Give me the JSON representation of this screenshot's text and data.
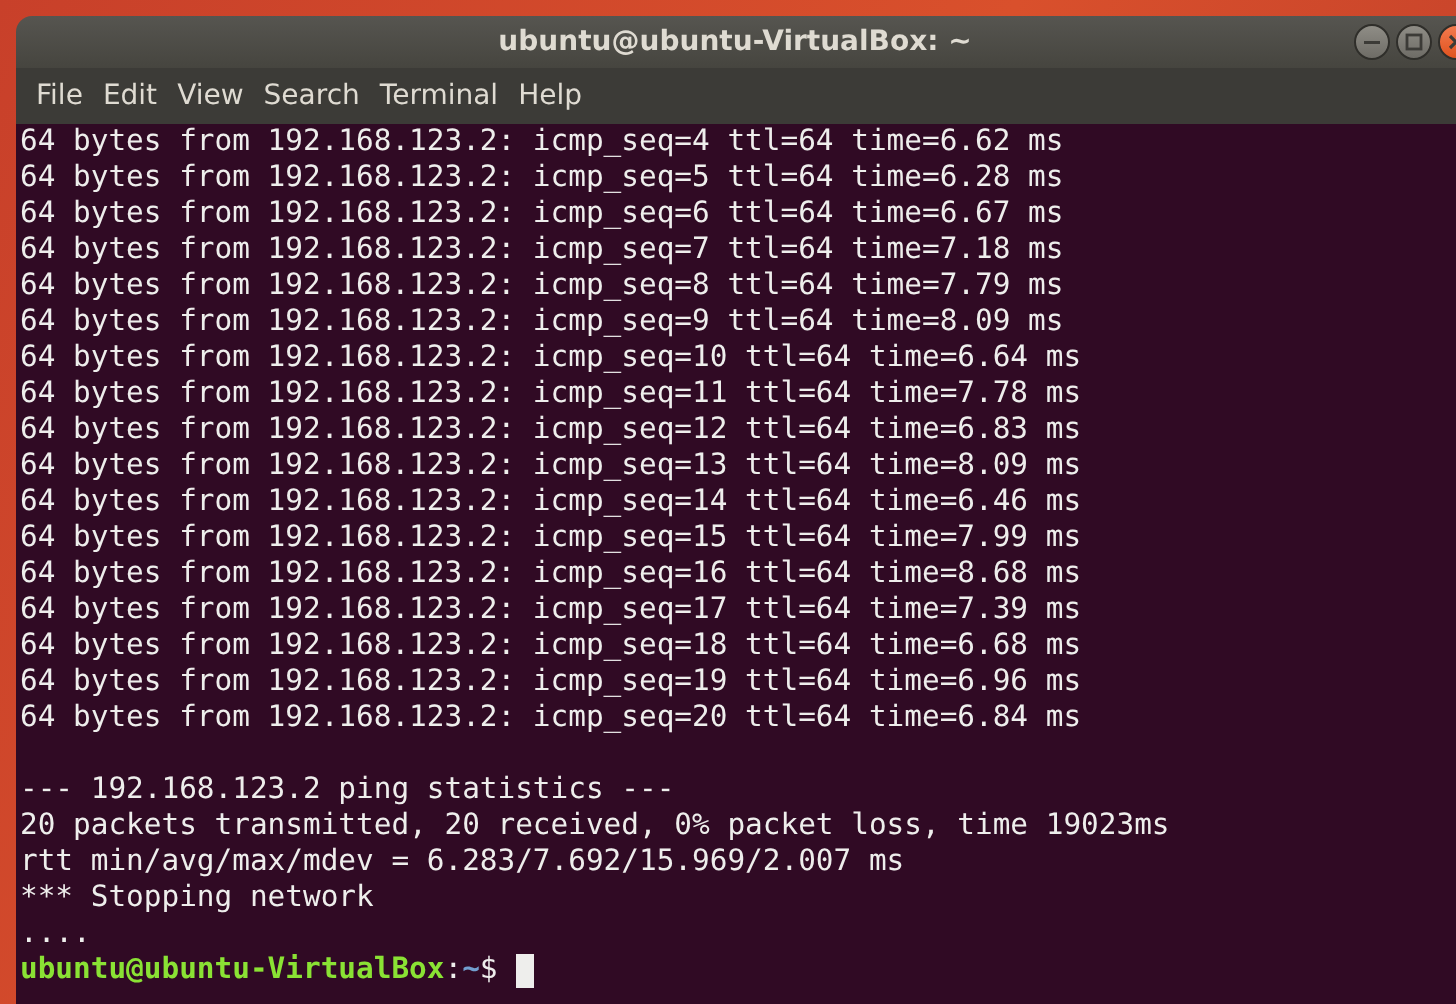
{
  "window": {
    "title": "ubuntu@ubuntu-VirtualBox: ~"
  },
  "menu": [
    "File",
    "Edit",
    "View",
    "Search",
    "Terminal",
    "Help"
  ],
  "terminal": {
    "replies": [
      "64 bytes from 192.168.123.2: icmp_seq=4 ttl=64 time=6.62 ms",
      "64 bytes from 192.168.123.2: icmp_seq=5 ttl=64 time=6.28 ms",
      "64 bytes from 192.168.123.2: icmp_seq=6 ttl=64 time=6.67 ms",
      "64 bytes from 192.168.123.2: icmp_seq=7 ttl=64 time=7.18 ms",
      "64 bytes from 192.168.123.2: icmp_seq=8 ttl=64 time=7.79 ms",
      "64 bytes from 192.168.123.2: icmp_seq=9 ttl=64 time=8.09 ms",
      "64 bytes from 192.168.123.2: icmp_seq=10 ttl=64 time=6.64 ms",
      "64 bytes from 192.168.123.2: icmp_seq=11 ttl=64 time=7.78 ms",
      "64 bytes from 192.168.123.2: icmp_seq=12 ttl=64 time=6.83 ms",
      "64 bytes from 192.168.123.2: icmp_seq=13 ttl=64 time=8.09 ms",
      "64 bytes from 192.168.123.2: icmp_seq=14 ttl=64 time=6.46 ms",
      "64 bytes from 192.168.123.2: icmp_seq=15 ttl=64 time=7.99 ms",
      "64 bytes from 192.168.123.2: icmp_seq=16 ttl=64 time=8.68 ms",
      "64 bytes from 192.168.123.2: icmp_seq=17 ttl=64 time=7.39 ms",
      "64 bytes from 192.168.123.2: icmp_seq=18 ttl=64 time=6.68 ms",
      "64 bytes from 192.168.123.2: icmp_seq=19 ttl=64 time=6.96 ms",
      "64 bytes from 192.168.123.2: icmp_seq=20 ttl=64 time=6.84 ms"
    ],
    "statistics": [
      "--- 192.168.123.2 ping statistics ---",
      "20 packets transmitted, 20 received, 0% packet loss, time 19023ms",
      "rtt min/avg/max/mdev = 6.283/7.692/15.969/2.007 ms",
      "*** Stopping network",
      "...."
    ],
    "prompt": {
      "user_host": "ubuntu@ubuntu-VirtualBox",
      "separator": ":",
      "path": "~",
      "symbol": "$"
    }
  }
}
